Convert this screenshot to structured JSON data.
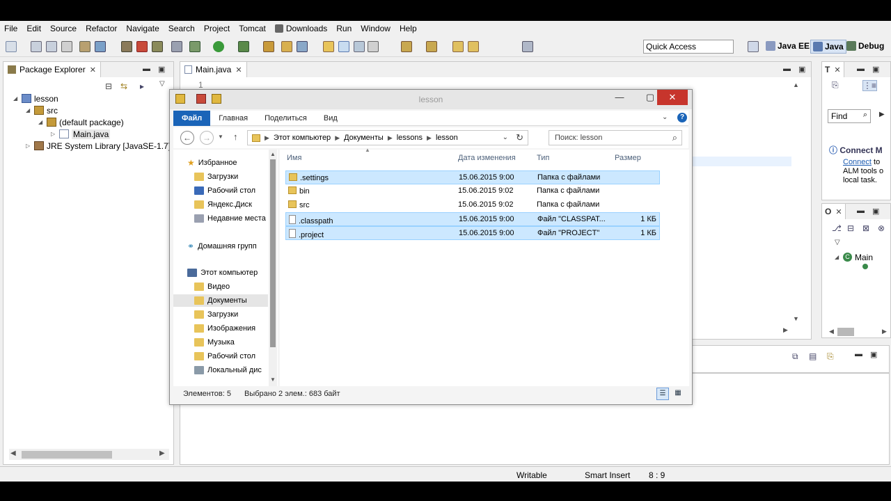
{
  "menu": [
    "File",
    "Edit",
    "Source",
    "Refactor",
    "Navigate",
    "Search",
    "Project",
    "Tomcat",
    "Downloads",
    "Run",
    "Window",
    "Help"
  ],
  "toolbar": {
    "quick_access": "Quick Access"
  },
  "perspectives": {
    "java_ee": "Java EE",
    "java": "Java",
    "debug": "Debug"
  },
  "package_explorer": {
    "title": "Package Explorer",
    "tree": [
      {
        "label": "lesson"
      },
      {
        "label": "src"
      },
      {
        "label": "(default package)"
      },
      {
        "label": "Main.java"
      },
      {
        "label": "JRE System Library [JavaSE-1.7]"
      }
    ]
  },
  "editor": {
    "tab": "Main.java",
    "line_number": "1"
  },
  "right_panel": {
    "find_label": "Find",
    "connect_title": "Connect M",
    "connect_link": "Connect",
    "connect_text_1": "to",
    "connect_text_2": "ALM tools o",
    "connect_text_3": "local task.",
    "outline_item": "Main"
  },
  "status_bar": {
    "writable": "Writable",
    "insert_mode": "Smart Insert",
    "position": "8 : 9"
  },
  "explorer": {
    "title": "lesson",
    "ribbon_tabs": [
      "Файл",
      "Главная",
      "Поделиться",
      "Вид"
    ],
    "breadcrumb": [
      "Этот компьютер",
      "Документы",
      "lessons",
      "lesson"
    ],
    "search_placeholder": "Поиск: lesson",
    "nav": {
      "favorites": "Избранное",
      "favorites_items": [
        "Загрузки",
        "Рабочий стол",
        "Яндекс.Диск",
        "Недавние места"
      ],
      "homegroup": "Домашняя групп",
      "computer": "Этот компьютер",
      "computer_items": [
        "Видео",
        "Документы",
        "Загрузки",
        "Изображения",
        "Музыка",
        "Рабочий стол",
        "Локальный дис"
      ]
    },
    "columns": {
      "name": "Имя",
      "date": "Дата изменения",
      "type": "Тип",
      "size": "Размер"
    },
    "files": [
      {
        "name": ".settings",
        "date": "15.06.2015 9:00",
        "type": "Папка с файлами",
        "size": "",
        "selected": true
      },
      {
        "name": "bin",
        "date": "15.06.2015 9:02",
        "type": "Папка с файлами",
        "size": "",
        "selected": false
      },
      {
        "name": "src",
        "date": "15.06.2015 9:02",
        "type": "Папка с файлами",
        "size": "",
        "selected": false
      },
      {
        "name": ".classpath",
        "date": "15.06.2015 9:00",
        "type": "Файл \"CLASSPAT...",
        "size": "1 КБ",
        "selected": true
      },
      {
        "name": ".project",
        "date": "15.06.2015 9:00",
        "type": "Файл \"PROJECT\"",
        "size": "1 КБ",
        "selected": true
      }
    ],
    "status_count": "Элементов: 5",
    "status_selected": "Выбрано 2 элем.: 683 байт"
  }
}
